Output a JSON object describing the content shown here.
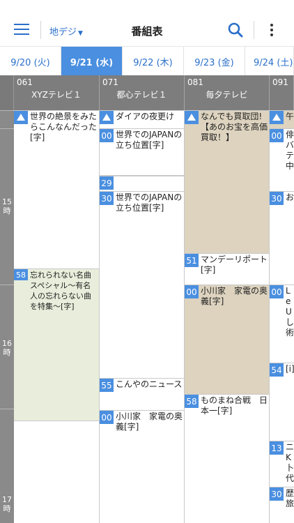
{
  "appbar": {
    "channel_type": "地デジ",
    "title": "番組表"
  },
  "dates": [
    {
      "label": "9/20 (火)",
      "active": false
    },
    {
      "label": "9/21 (水)",
      "active": true
    },
    {
      "label": "9/22 (木)",
      "active": false
    },
    {
      "label": "9/23 (金)",
      "active": false
    },
    {
      "label": "9/24 (土)",
      "active": false
    }
  ],
  "channels": [
    {
      "number": "061",
      "name": "XYZテレビ１"
    },
    {
      "number": "071",
      "name": "都心テレビ１"
    },
    {
      "number": "081",
      "name": "毎夕テレビ"
    },
    {
      "number": "091",
      "name": ""
    }
  ],
  "hours": [
    "15\n時",
    "16\n時",
    "17\n時"
  ],
  "programs": {
    "col0": [
      {
        "minute": "▲",
        "title": "世界の絶景をみたらこんなんだった[字]",
        "style": "white"
      },
      {
        "minute": "58",
        "title": "忘れられない名曲スペシャル〜有名人の忘れらない曲を特集〜[字]",
        "style": "green"
      }
    ],
    "col1": [
      {
        "minute": "▲",
        "title": "ダイアの夜更け",
        "style": "white"
      },
      {
        "minute": "00",
        "title": "世界でのJAPANの立ち位置[字]",
        "style": "white"
      },
      {
        "minute": "29",
        "title": "",
        "style": "white"
      },
      {
        "minute": "30",
        "title": "世界でのJAPANの立ち位置[字]",
        "style": "white"
      },
      {
        "minute": "55",
        "title": "こんやのニュース",
        "style": "white"
      },
      {
        "minute": "00",
        "title": "小川家　家電の奥義[字]",
        "style": "white"
      }
    ],
    "col2": [
      {
        "minute": "▲",
        "title": "なんでも買取団!【あのお宝を高価買取！】",
        "style": "beige"
      },
      {
        "minute": "51",
        "title": "マンデーリポート[字]",
        "style": "white"
      },
      {
        "minute": "00",
        "title": "小川家　家電の奥義[字]",
        "style": "beige"
      },
      {
        "minute": "58",
        "title": "ものまね合戦　日本一[字]",
        "style": "white"
      }
    ],
    "col3": [
      {
        "minute": "▲",
        "title": "午",
        "style": "beige"
      },
      {
        "minute": "00",
        "title": "俳バテ中",
        "style": "white"
      },
      {
        "minute": "30",
        "title": "お",
        "style": "white"
      },
      {
        "minute": "00",
        "title": "LeUし術",
        "style": "white"
      },
      {
        "minute": "54",
        "title": "[i]",
        "style": "white"
      },
      {
        "minute": "13",
        "title": "ニK卜代",
        "style": "white"
      },
      {
        "minute": "30",
        "title": "歴旅",
        "style": "white"
      }
    ]
  }
}
